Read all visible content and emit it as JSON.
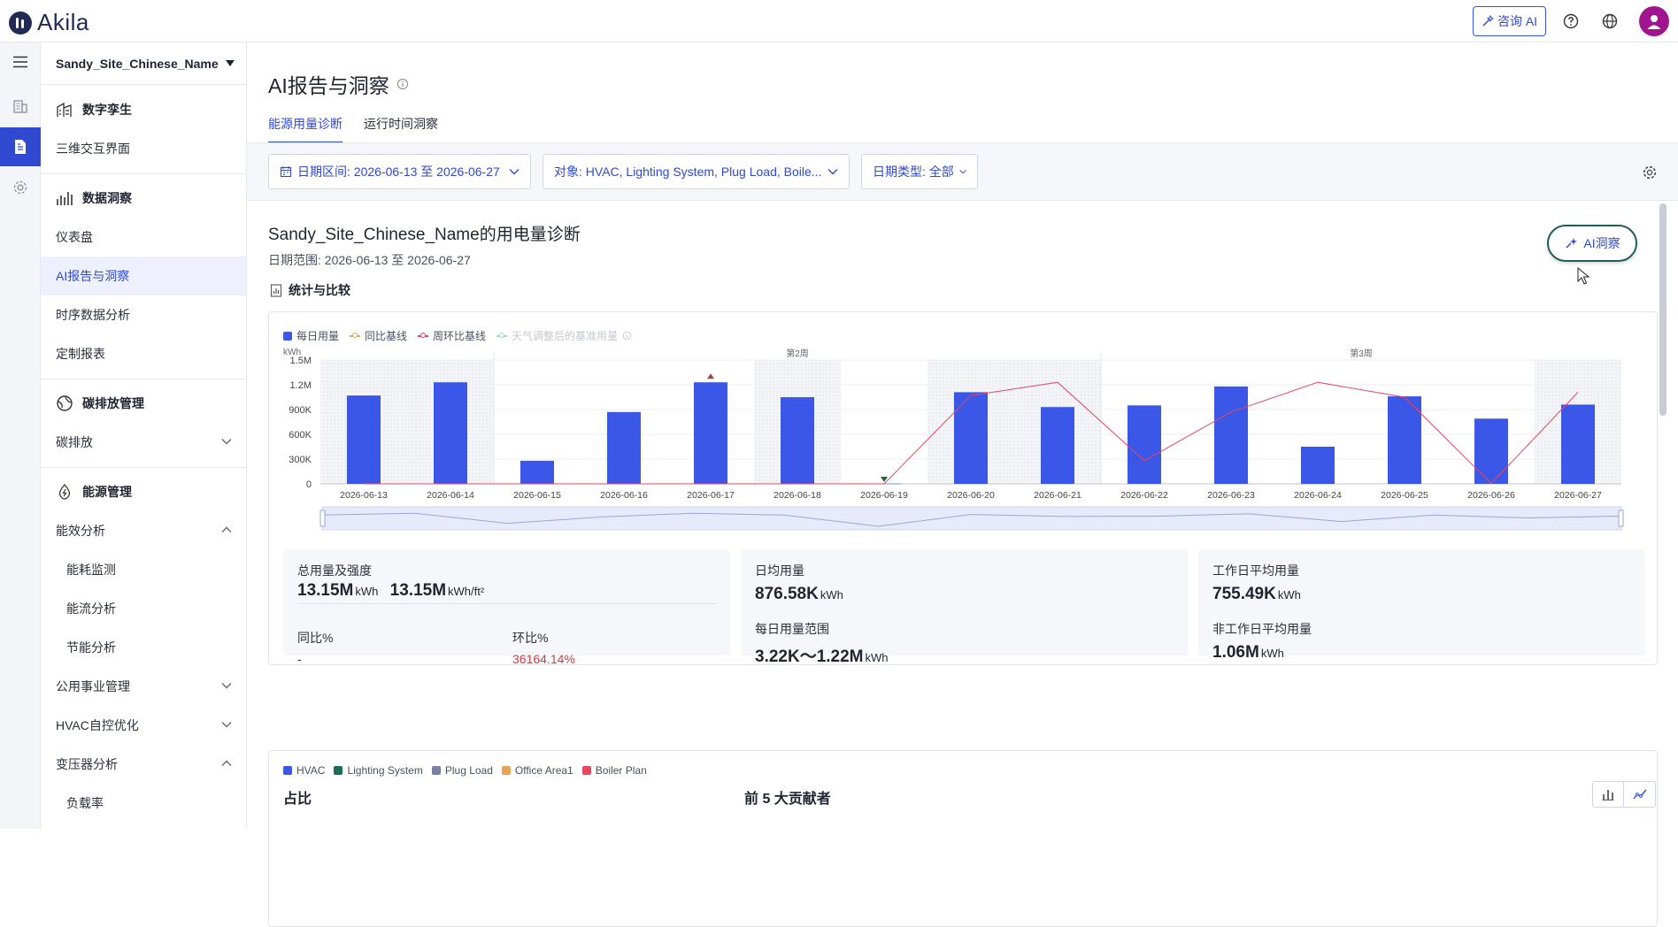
{
  "app": {
    "logo_text": "Akila",
    "ask_ai_label": "咨询 AI"
  },
  "sidebar": {
    "site_name": "Sandy_Site_Chinese_Name",
    "sections": [
      {
        "title": "数字孪生",
        "items": [
          "三维交互界面"
        ]
      },
      {
        "title": "数据洞察",
        "items": [
          "仪表盘",
          "AI报告与洞察",
          "时序数据分析",
          "定制报表"
        ]
      },
      {
        "title": "碳排放管理",
        "items": [
          "碳排放"
        ]
      },
      {
        "title": "能源管理",
        "items": [
          "能效分析",
          "能耗监测",
          "能流分析",
          "节能分析",
          "公用事业管理",
          "HVAC自控优化",
          "变压器分析",
          "负载率"
        ]
      }
    ],
    "active_item": "AI报告与洞察"
  },
  "page": {
    "title": "AI报告与洞察",
    "tabs": [
      "能源用量诊断",
      "运行时间洞察"
    ],
    "active_tab": "能源用量诊断"
  },
  "filters": {
    "date_range": "日期区间: 2026-06-13 至 2026-06-27",
    "objects": "对象: HVAC, Lighting System, Plug Load, Boile...",
    "date_type": "日期类型: 全部"
  },
  "diagnosis": {
    "title": "Sandy_Site_Chinese_Name的用电量诊断",
    "range": "日期范围: 2026-06-13 至 2026-06-27",
    "ai_button": "AI洞察",
    "stats_heading": "统计与比较"
  },
  "chart_data": {
    "type": "bar",
    "unit": "kWh",
    "legend": [
      "每日用量",
      "同比基线",
      "周环比基线",
      "天气调整后的基准用量"
    ],
    "week_labels": [
      "第2周",
      "第3周"
    ],
    "categories": [
      "2026-06-13",
      "2026-06-14",
      "2026-06-15",
      "2026-06-16",
      "2026-06-17",
      "2026-06-18",
      "2026-06-19",
      "2026-06-20",
      "2026-06-21",
      "2026-06-22",
      "2026-06-23",
      "2026-06-24",
      "2026-06-25",
      "2026-06-26",
      "2026-06-27"
    ],
    "y_ticks": [
      "0",
      "300K",
      "600K",
      "900K",
      "1.2M",
      "1.5M"
    ],
    "ylim": [
      0,
      1500000
    ],
    "series": [
      {
        "name": "每日用量",
        "type": "bar",
        "color": "#3b57e8",
        "values": [
          1070000,
          1230000,
          280000,
          870000,
          1230000,
          1050000,
          3220,
          1110000,
          930000,
          950000,
          1180000,
          450000,
          1060000,
          790000,
          960000
        ]
      },
      {
        "name": "周环比基线",
        "type": "line",
        "color": "#e8475f",
        "values": [
          0,
          0,
          0,
          0,
          0,
          0,
          0,
          1070000,
          1230000,
          280000,
          870000,
          1230000,
          1050000,
          3220,
          1110000
        ]
      }
    ],
    "weekend_shade": [
      [
        0,
        1
      ],
      [
        5,
        5
      ],
      [
        7,
        8
      ],
      [
        14,
        14
      ]
    ],
    "markers": [
      {
        "index": 4,
        "kind": "up",
        "color": "#a0463a"
      },
      {
        "index": 6,
        "kind": "down",
        "color": "#1f6b3a"
      }
    ]
  },
  "kpis": {
    "total_label": "总用量及强度",
    "total_value": "13.15M",
    "total_unit": "kWh",
    "intensity_value": "13.15M",
    "intensity_unit": "kWh/ft²",
    "yoy_label": "同比%",
    "yoy_value": "-",
    "mom_label": "环比%",
    "mom_value": "36164.14%",
    "daily_avg_label": "日均用量",
    "daily_avg_value": "876.58K",
    "daily_avg_unit": "kWh",
    "daily_range_label": "每日用量范围",
    "daily_range_value": "3.22K～1.22M",
    "daily_range_unit": "kWh",
    "workday_label": "工作日平均用量",
    "workday_value": "755.49K",
    "workday_unit": "kWh",
    "nonworkday_label": "非工作日平均用量",
    "nonworkday_value": "1.06M",
    "nonworkday_unit": "kWh"
  },
  "breakdown": {
    "legend": [
      {
        "name": "HVAC",
        "color": "#3b57e8"
      },
      {
        "name": "Lighting System",
        "color": "#1f6b5a"
      },
      {
        "name": "Plug Load",
        "color": "#7a7fa6"
      },
      {
        "name": "Office Area1",
        "color": "#e8a25a"
      },
      {
        "name": "Boiler Plan",
        "color": "#e8475f"
      }
    ],
    "share_title": "占比",
    "top5_title": "前 5 大贡献者"
  }
}
